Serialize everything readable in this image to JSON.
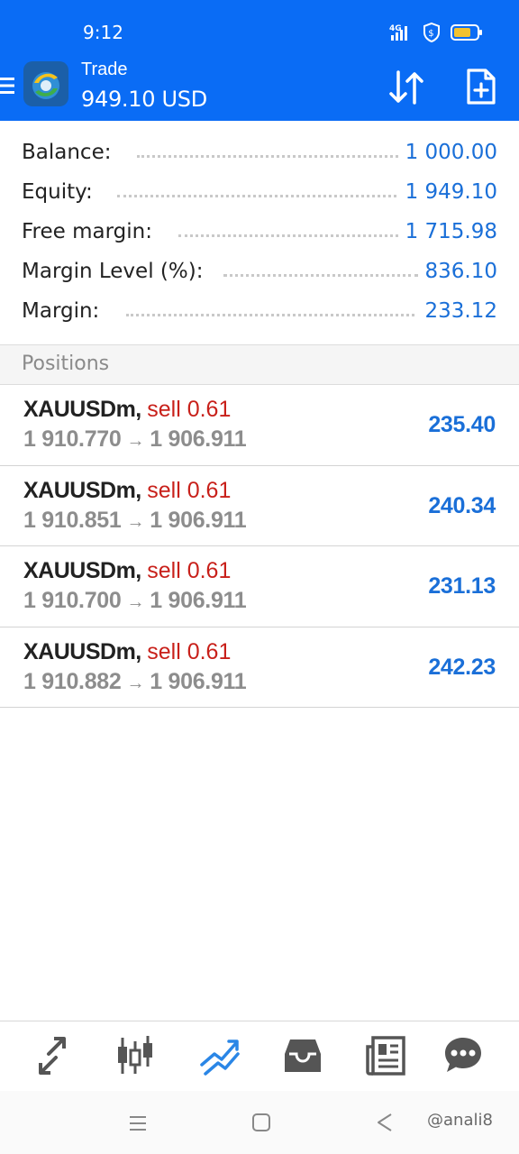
{
  "status_bar": {
    "time": "9:12",
    "network": "4G",
    "icons": [
      "signal-icon",
      "vpn-icon",
      "battery-icon"
    ],
    "battery_color": "#f2c230"
  },
  "app_bar": {
    "title": "Trade",
    "balance": "949.10 USD",
    "actions": [
      "sort-icon",
      "new-order-icon"
    ]
  },
  "summary": [
    {
      "label": "Balance:",
      "value": "1 000.00"
    },
    {
      "label": "Equity:",
      "value": "1 949.10"
    },
    {
      "label": "Free margin:",
      "value": "1 715.98"
    },
    {
      "label": "Margin Level (%):",
      "value": "836.10"
    },
    {
      "label": "Margin:",
      "value": "233.12"
    }
  ],
  "positions": {
    "title": "Positions",
    "items": [
      {
        "symbol": "XAUUSDm",
        "direction": "sell 0.61",
        "open": "1 910.770",
        "arrow": "→",
        "current": "1 906.911",
        "profit": "235.40"
      },
      {
        "symbol": "XAUUSDm",
        "direction": "sell 0.61",
        "open": "1 910.851",
        "arrow": "→",
        "current": "1 906.911",
        "profit": "240.34"
      },
      {
        "symbol": "XAUUSDm",
        "direction": "sell 0.61",
        "open": "1 910.700",
        "arrow": "→",
        "current": "1 906.911",
        "profit": "231.13"
      },
      {
        "symbol": "XAUUSDm",
        "direction": "sell 0.61",
        "open": "1 910.882",
        "arrow": "→",
        "current": "1 906.911",
        "profit": "242.23"
      }
    ]
  },
  "bottom_nav": {
    "items": [
      "quotes-icon",
      "chart-icon",
      "trade-icon",
      "history-icon",
      "news-icon",
      "chat-icon"
    ],
    "active": "trade-icon"
  },
  "colors": {
    "accent": "#0a6cf5",
    "value_blue": "#1a6fd8",
    "sell_red": "#c8201a"
  },
  "watermark": "@anali8"
}
